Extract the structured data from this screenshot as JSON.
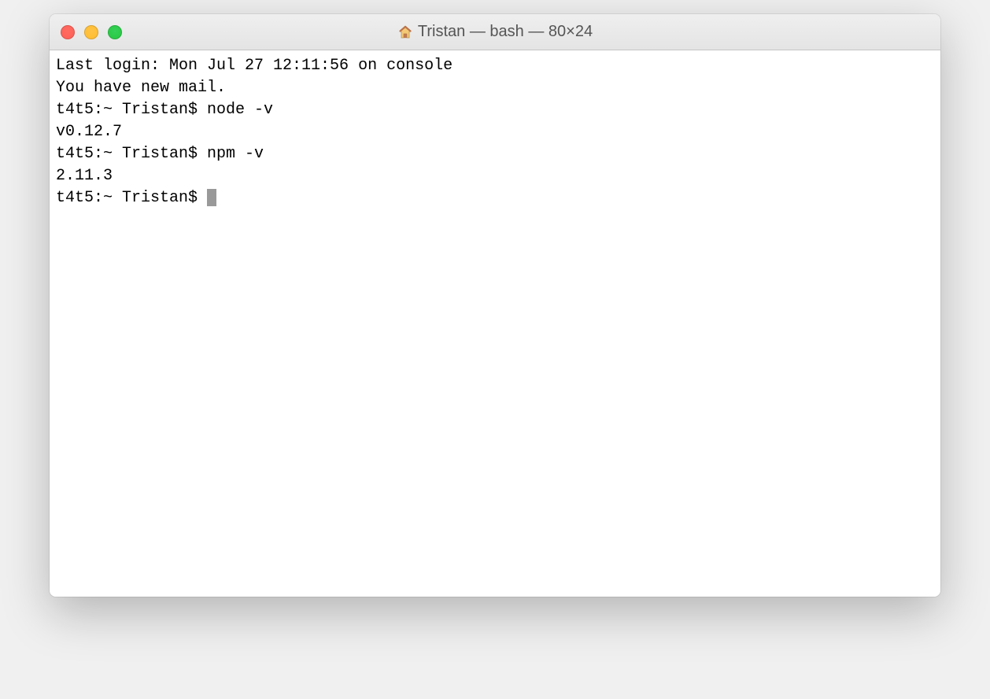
{
  "window": {
    "title": "Tristan — bash — 80×24"
  },
  "terminal": {
    "lines": [
      "Last login: Mon Jul 27 12:11:56 on console",
      "You have new mail.",
      "t4t5:~ Tristan$ node -v",
      "v0.12.7",
      "t4t5:~ Tristan$ npm -v",
      "2.11.3"
    ],
    "current_prompt": "t4t5:~ Tristan$ "
  }
}
